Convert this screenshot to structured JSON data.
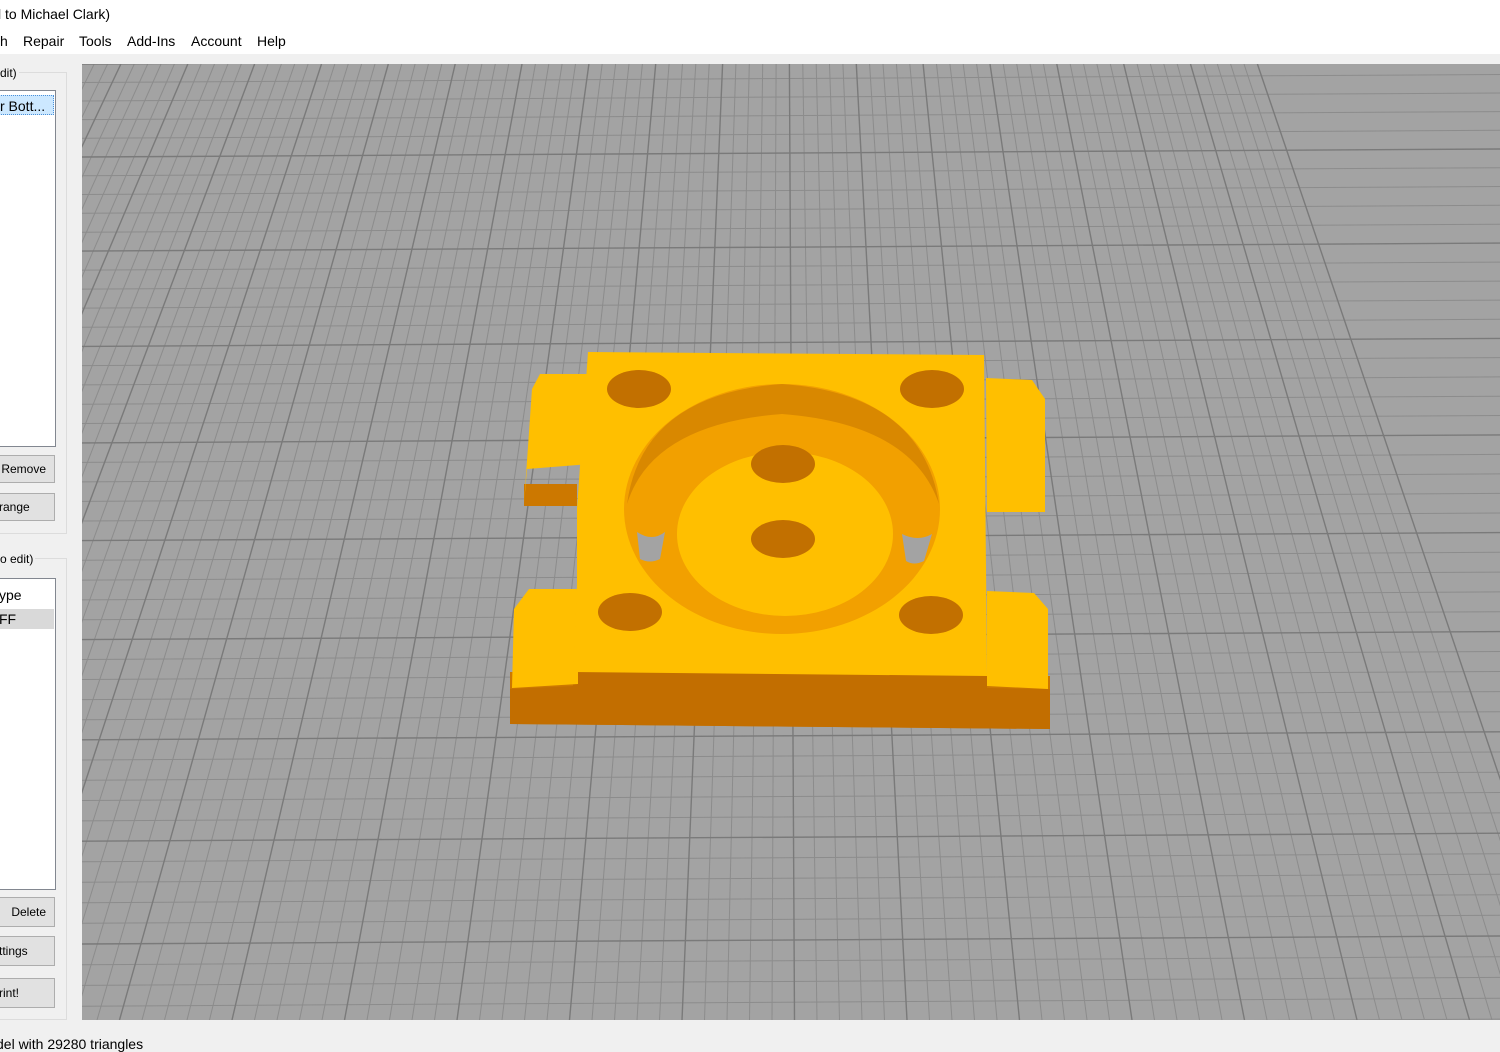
{
  "window": {
    "title": "l to Michael Clark)"
  },
  "menu": [
    "h",
    "Repair",
    "Tools",
    "Add-Ins",
    "Account",
    "Help"
  ],
  "models_panel": {
    "group_label": "dit)",
    "items": [
      "r Bott..."
    ],
    "buttons": {
      "remove": "Remove",
      "arrange": "range"
    }
  },
  "printer_panel": {
    "group_label": "o edit)",
    "items": [
      "ype",
      "FF"
    ],
    "buttons": {
      "delete": "Delete",
      "settings": "ttings",
      "print": "rint!"
    }
  },
  "status": {
    "text": "del with 29280 triangles"
  },
  "viewport": {
    "background": "#a3a3a3",
    "grid_color": "#8c8c8c",
    "model_color": "#ffbf00",
    "model_shade": "#cc7a00"
  }
}
